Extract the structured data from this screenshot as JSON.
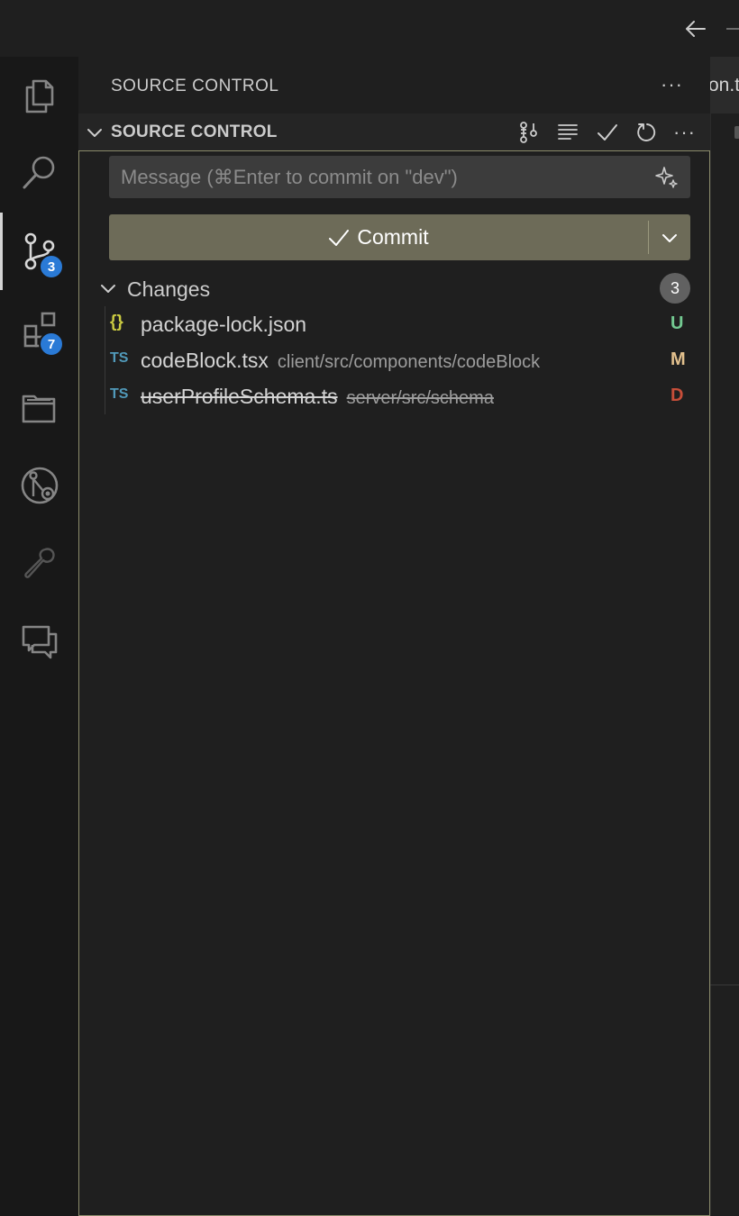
{
  "sidebar": {
    "title": "SOURCE CONTROL",
    "more": "···"
  },
  "editor": {
    "tab_fragment": "on.t"
  },
  "activity_bar": {
    "badges": {
      "source_control": "3",
      "extensions": "7"
    }
  },
  "section": {
    "title": "SOURCE CONTROL",
    "more": "···"
  },
  "commit": {
    "message_placeholder": "Message (⌘Enter to commit on \"dev\")",
    "button_label": "Commit"
  },
  "changes": {
    "label": "Changes",
    "count": "3",
    "files": [
      {
        "icon": "{}",
        "name": "package-lock.json",
        "path": "",
        "status": "U"
      },
      {
        "icon": "TS",
        "name": "codeBlock.tsx",
        "path": "client/src/components/codeBlock",
        "status": "M"
      },
      {
        "icon": "TS",
        "name": "userProfileSchema.ts",
        "path": "server/src/schema",
        "status": "D"
      }
    ]
  },
  "colors": {
    "accent_badge": "#2a7ad6",
    "commit_button": "#6d6b58",
    "status_untracked": "#73c991",
    "status_modified": "#e2c08d",
    "status_deleted": "#c74e39",
    "ts_icon": "#519aba",
    "json_icon": "#cbcb41"
  }
}
